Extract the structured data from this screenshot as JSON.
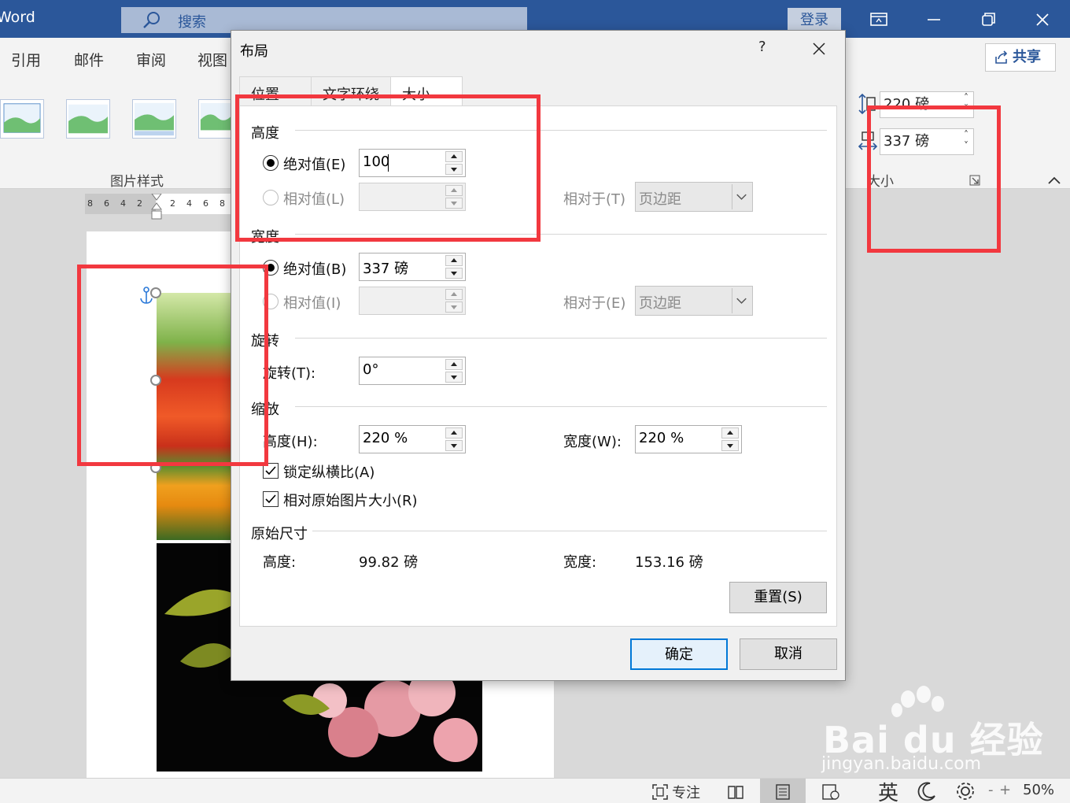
{
  "titlebar": {
    "app_name": "Word",
    "search_label": "搜索",
    "login_label": "登录"
  },
  "ribbon": {
    "tabs": [
      "引用",
      "邮件",
      "审阅",
      "视图"
    ],
    "share_label": "共享",
    "group_label": "图片样式",
    "size_group_label": "大小",
    "height_value": "220 磅",
    "width_value": "337 磅"
  },
  "ruler": {
    "left_numbers": [
      "8",
      "6",
      "4",
      "2"
    ],
    "right_numbers": [
      "2",
      "4",
      "6",
      "8"
    ]
  },
  "dialog": {
    "title": "布局",
    "help": "?",
    "tabs": [
      "位置",
      "文字环绕",
      "大小"
    ],
    "active_tab": "大小",
    "height": {
      "section": "高度",
      "absolute_label": "绝对值(E)",
      "absolute_value": "100",
      "relative_label": "相对值(L)",
      "relative_value": "",
      "relative_to_label": "相对于(T)",
      "relative_to_value": "页边距"
    },
    "width": {
      "section": "宽度",
      "absolute_label": "绝对值(B)",
      "absolute_value": "337 磅",
      "relative_label": "相对值(I)",
      "relative_value": "",
      "relative_to_label": "相对于(E)",
      "relative_to_value": "页边距"
    },
    "rotation": {
      "section": "旋转",
      "label": "旋转(T):",
      "value": "0°"
    },
    "scale": {
      "section": "缩放",
      "height_label": "高度(H):",
      "height_value": "220 %",
      "width_label": "宽度(W):",
      "width_value": "220 %",
      "lock_aspect_label": "锁定纵横比(A)",
      "lock_aspect_checked": true,
      "relative_original_label": "相对原始图片大小(R)",
      "relative_original_checked": true
    },
    "original": {
      "section": "原始尺寸",
      "height_label": "高度:",
      "height_value": "99.82 磅",
      "width_label": "宽度:",
      "width_value": "153.16 磅"
    },
    "reset_label": "重置(S)",
    "ok_label": "确定",
    "cancel_label": "取消"
  },
  "statusbar": {
    "focus_label": "专注",
    "ime_label": "英",
    "zoom_value": "50%"
  },
  "watermark": {
    "brand": "Bai du 经验",
    "url": "jingyan.baidu.com"
  },
  "colors": {
    "titlebar": "#2b579a",
    "highlight": "#f2383f",
    "ok_border": "#0078d7"
  }
}
